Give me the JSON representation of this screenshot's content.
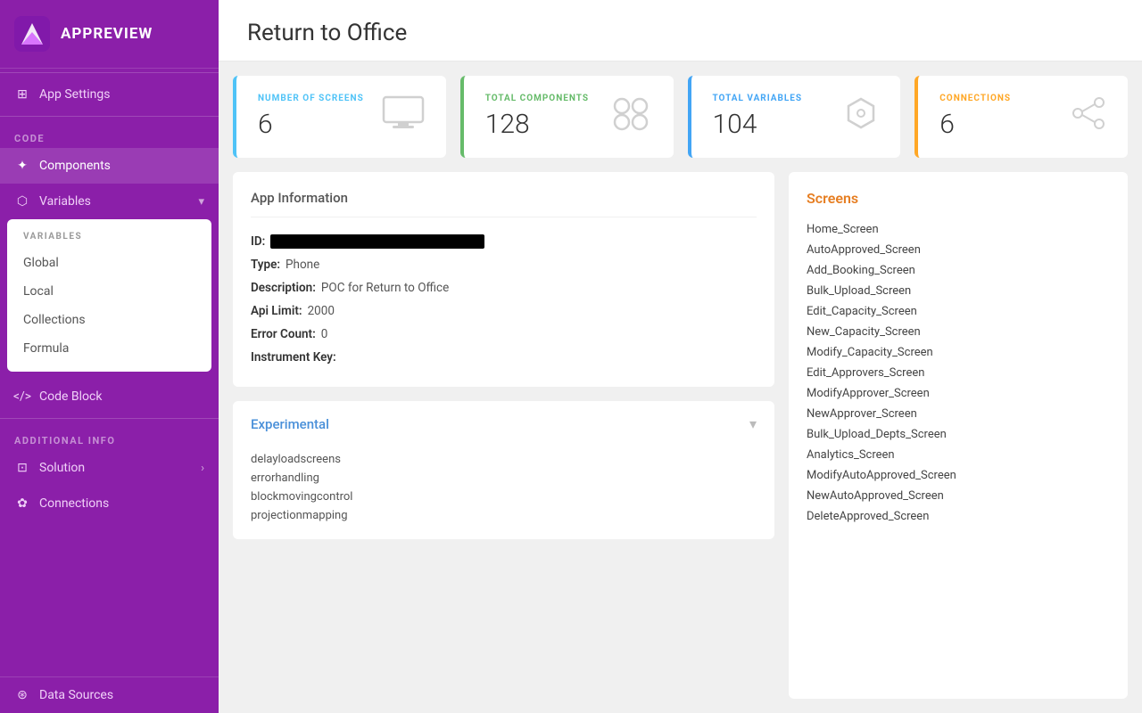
{
  "app": {
    "name": "APPREVIEW"
  },
  "sidebar": {
    "app_settings_label": "App Settings",
    "code_section": "CODE",
    "components_label": "Components",
    "variables_label": "Variables",
    "variables_submenu_header": "VARIABLES",
    "variables_submenu": [
      {
        "label": "Global"
      },
      {
        "label": "Local"
      },
      {
        "label": "Collections"
      },
      {
        "label": "Formula"
      }
    ],
    "code_block_label": "Code Block",
    "additional_info_section": "ADDITIONAL INFO",
    "solution_label": "Solution",
    "connections_label": "Connections",
    "data_sources_label": "Data Sources"
  },
  "main": {
    "title": "Return to Office",
    "stats": [
      {
        "label": "NUMBER OF SCREENS",
        "value": "6",
        "icon": "🖥"
      },
      {
        "label": "TOTAL COMPONENTS",
        "value": "128",
        "icon": "⚙"
      },
      {
        "label": "TOTAL VARIABLES",
        "value": "104",
        "icon": "🏷"
      },
      {
        "label": "CONNECTIONS",
        "value": "6",
        "icon": "🔗"
      }
    ],
    "app_info": {
      "title": "App Information",
      "fields": [
        {
          "label": "ID:",
          "value": "REDACTED",
          "redacted": true
        },
        {
          "label": "Type:",
          "value": "Phone"
        },
        {
          "label": "Description:",
          "value": "POC for Return to Office"
        },
        {
          "label": "Api Limit:",
          "value": "2000"
        },
        {
          "label": "Error Count:",
          "value": "0"
        },
        {
          "label": "Instrument Key:",
          "value": ""
        }
      ]
    },
    "experimental": {
      "title": "Experimental",
      "items": [
        "delayloadscreens",
        "errorhandling",
        "blockmovingcontrol",
        "projectionmapping"
      ]
    },
    "screens": {
      "title": "Screens",
      "items": [
        "Home_Screen",
        "AutoApproved_Screen",
        "Add_Booking_Screen",
        "Bulk_Upload_Screen",
        "Edit_Capacity_Screen",
        "New_Capacity_Screen",
        "Modify_Capacity_Screen",
        "Edit_Approvers_Screen",
        "ModifyApprover_Screen",
        "NewApprover_Screen",
        "Bulk_Upload_Depts_Screen",
        "Analytics_Screen",
        "ModifyAutoApproved_Screen",
        "NewAutoApproved_Screen",
        "DeleteApproved_Screen"
      ]
    }
  }
}
